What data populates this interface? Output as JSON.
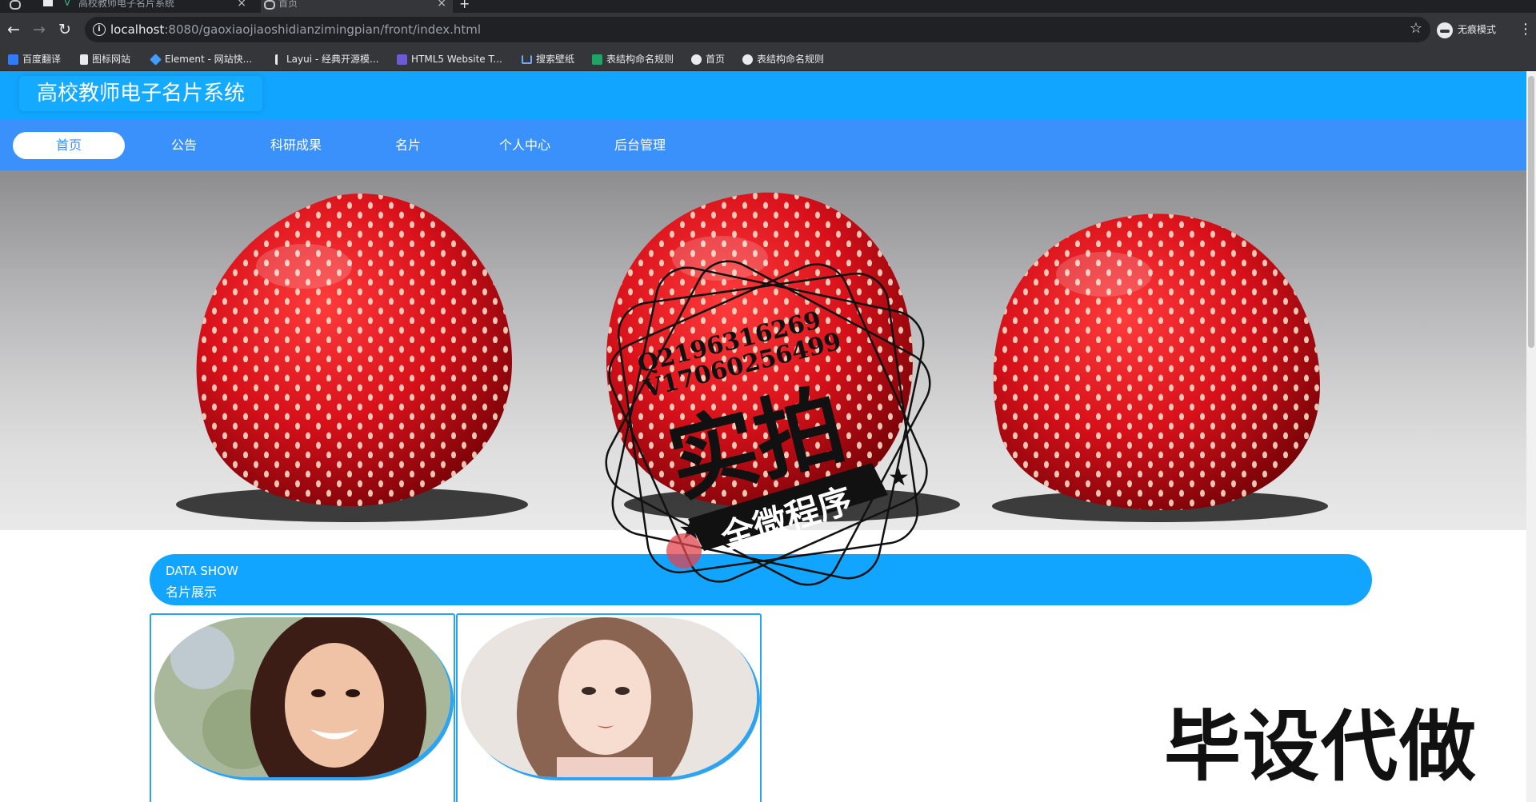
{
  "browser": {
    "tabs": [
      {
        "title": "",
        "active": false
      },
      {
        "title": "高校教师电子名片系统",
        "active": false
      },
      {
        "title": "首页",
        "active": true
      }
    ],
    "new_tab": "+",
    "url_host": "localhost",
    "url_rest": ":8080/gaoxiaojiaoshidianzimingpian/front/index.html",
    "incognito_label": "无痕模式",
    "bookmarks": [
      "百度翻译",
      "图标网站",
      "Element - 网站快...",
      "Layui - 经典开源模...",
      "HTML5 Website T...",
      "搜索壁纸",
      "表结构命名规则",
      "首页",
      "表结构命名规则"
    ]
  },
  "site": {
    "title": "高校教师电子名片系统",
    "nav": [
      "首页",
      "公告",
      "科研成果",
      "名片",
      "个人中心",
      "后台管理"
    ]
  },
  "section": {
    "en": "DATA SHOW",
    "cn": "名片展示"
  },
  "cards": [
    {
      "name": ""
    },
    {
      "name": ""
    }
  ],
  "watermark": {
    "qq": "Q2196316269",
    "vx": "V17060256499",
    "big": "实拍",
    "ribbon": "全微程序",
    "corner": "毕设代做"
  },
  "colors": {
    "header": "#11a5ff",
    "nav": "#3a91fb",
    "accent": "#29a4f5"
  }
}
